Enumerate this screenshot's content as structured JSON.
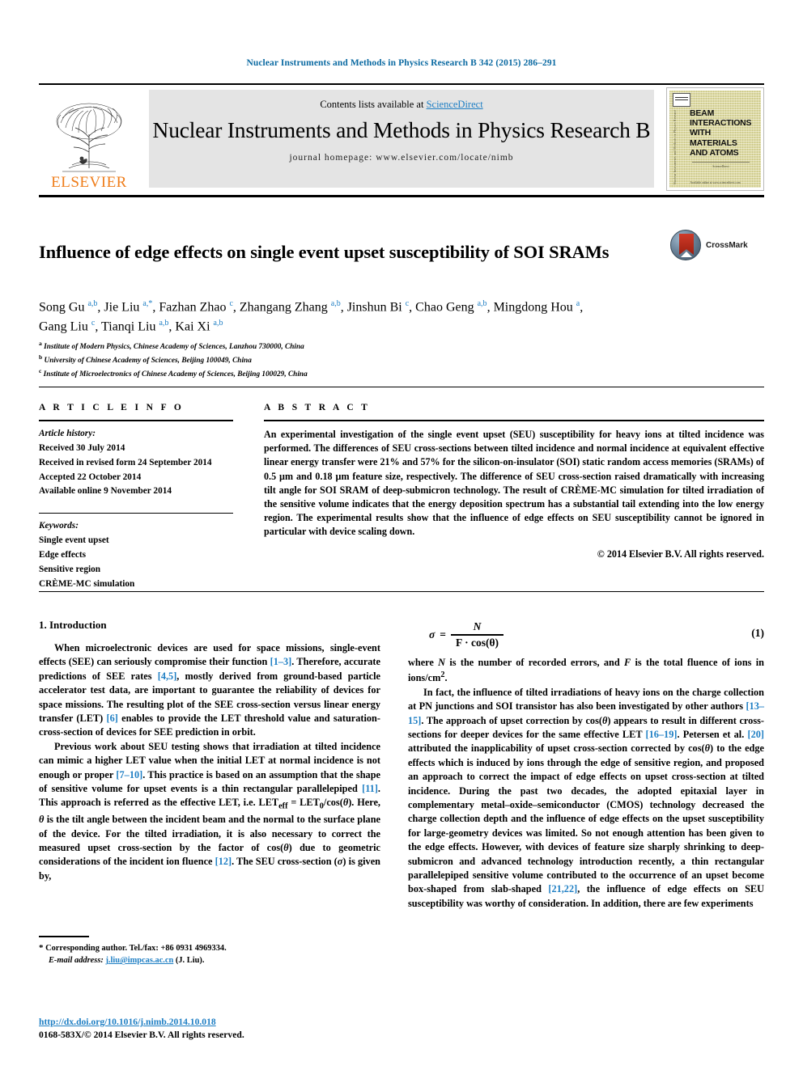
{
  "running_head": "Nuclear Instruments and Methods in Physics Research B 342 (2015) 286–291",
  "masthead": {
    "contents_prefix": "Contents lists available at ",
    "sciencedirect": "ScienceDirect",
    "journal_title": "Nuclear Instruments and Methods in Physics Research B",
    "homepage": "journal homepage: www.elsevier.com/locate/nimb",
    "publisher_wordmark": "ELSEVIER",
    "cover": {
      "title_lines": [
        "BEAM",
        "INTERACTIONS",
        "WITH",
        "MATERIALS",
        "AND ATOMS"
      ],
      "spine_text": "Nuclear Instruments and Methods in Physics Research B",
      "mid_text": "ScienceDirect",
      "foot_text": "Available online at www.sciencedirect.com"
    }
  },
  "article": {
    "title": "Influence of edge effects on single event upset susceptibility of SOI SRAMs",
    "crossmark_label": "CrossMark",
    "authors_line1": "Song Gu a,b, Jie Liu a,*, Fazhan Zhao c, Zhangang Zhang a,b, Jinshun Bi c, Chao Geng a,b, Mingdong Hou a,",
    "authors_line2": "Gang Liu c, Tianqi Liu a,b, Kai Xi a,b",
    "authors": [
      {
        "name": "Song Gu",
        "sup": "a,b"
      },
      {
        "name": "Jie Liu",
        "sup": "a,*"
      },
      {
        "name": "Fazhan Zhao",
        "sup": "c"
      },
      {
        "name": "Zhangang Zhang",
        "sup": "a,b"
      },
      {
        "name": "Jinshun Bi",
        "sup": "c"
      },
      {
        "name": "Chao Geng",
        "sup": "a,b"
      },
      {
        "name": "Mingdong Hou",
        "sup": "a"
      },
      {
        "name": "Gang Liu",
        "sup": "c"
      },
      {
        "name": "Tianqi Liu",
        "sup": "a,b"
      },
      {
        "name": "Kai Xi",
        "sup": "a,b"
      }
    ],
    "affiliations": [
      {
        "mark": "a",
        "text": "Institute of Modern Physics, Chinese Academy of Sciences, Lanzhou 730000, China"
      },
      {
        "mark": "b",
        "text": "University of Chinese Academy of Sciences, Beijing 100049, China"
      },
      {
        "mark": "c",
        "text": "Institute of Microelectronics of Chinese Academy of Sciences, Beijing 100029, China"
      }
    ]
  },
  "article_info": {
    "heading": "A R T I C L E  I N F O",
    "history_label": "Article history:",
    "history": [
      "Received 30 July 2014",
      "Received in revised form 24 September 2014",
      "Accepted 22 October 2014",
      "Available online 9 November 2014"
    ],
    "keywords_label": "Keywords:",
    "keywords": [
      "Single event upset",
      "Edge effects",
      "Sensitive region",
      "CRÈME-MC simulation"
    ]
  },
  "abstract": {
    "heading": "A B S T R A C T",
    "text": "An experimental investigation of the single event upset (SEU) susceptibility for heavy ions at tilted incidence was performed. The differences of SEU cross-sections between tilted incidence and normal incidence at equivalent effective linear energy transfer were 21% and 57% for the silicon-on-insulator (SOI) static random access memories (SRAMs) of 0.5 µm and 0.18 µm feature size, respectively. The difference of SEU cross-section raised dramatically with increasing tilt angle for SOI SRAM of deep-submicron technology. The result of CRÈME-MC simulation for tilted irradiation of the sensitive volume indicates that the energy deposition spectrum has a substantial tail extending into the low energy region. The experimental results show that the influence of edge effects on SEU susceptibility cannot be ignored in particular with device scaling down.",
    "copyright": "© 2014 Elsevier B.V. All rights reserved."
  },
  "body": {
    "section_heading": "1. Introduction",
    "left_paragraphs": [
      "When microelectronic devices are used for space missions, single-event effects (SEE) can seriously compromise their function [1–3]. Therefore, accurate predictions of SEE rates [4,5], mostly derived from ground-based particle accelerator test data, are important to guarantee the reliability of devices for space missions. The resulting plot of the SEE cross-section versus linear energy transfer (LET) [6] enables to provide the LET threshold value and saturation-cross-section of devices for SEE prediction in orbit.",
      "Previous work about SEU testing shows that irradiation at tilted incidence can mimic a higher LET value when the initial LET at normal incidence is not enough or proper [7–10]. This practice is based on an assumption that the shape of sensitive volume for upset events is a thin rectangular parallelepiped [11]. This approach is referred as the effective LET, i.e. LETeff = LET0/cos(θ). Here, θ is the tilt angle between the incident beam and the normal to the surface plane of the device. For the tilted irradiation, it is also necessary to correct the measured upset cross-section by the factor of cos(θ) due to geometric considerations of the incident ion fluence [12]. The SEU cross-section (σ) is given by,"
    ],
    "equation": {
      "lhs": "σ",
      "equals": "=",
      "numerator": "N",
      "denominator": "F · cos(θ)",
      "number": "(1)"
    },
    "right_paragraphs": [
      "where N is the number of recorded errors, and F is the total fluence of ions in ions/cm2.",
      "In fact, the influence of tilted irradiations of heavy ions on the charge collection at PN junctions and SOI transistor has also been investigated by other authors [13–15]. The approach of upset correction by cos(θ) appears to result in different cross-sections for deeper devices for the same effective LET [16–19]. Petersen et al. [20] attributed the inapplicability of upset cross-section corrected by cos(θ) to the edge effects which is induced by ions through the edge of sensitive region, and proposed an approach to correct the impact of edge effects on upset cross-section at tilted incidence. During the past two decades, the adopted epitaxial layer in complementary metal–oxide–semiconductor (CMOS) technology decreased the charge collection depth and the influence of edge effects on the upset susceptibility for large-geometry devices was limited. So not enough attention has been given to the edge effects. However, with devices of feature size sharply shrinking to deep-submicron and advanced technology introduction recently, a thin rectangular parallelepiped sensitive volume contributed to the occurrence of an upset become box-shaped from slab-shaped [21,22], the influence of edge effects on SEU susceptibility was worthy of consideration. In addition, there are few experiments"
    ]
  },
  "footnote": {
    "star": "*",
    "corresponding": "Corresponding author. Tel./fax: +86 0931 4969334.",
    "email_label": "E-mail address:",
    "email": "j.liu@impcas.ac.cn",
    "email_suffix": "(J. Liu)."
  },
  "page_footer": {
    "doi": "http://dx.doi.org/10.1016/j.nimb.2014.10.018",
    "issn": "0168-583X/© 2014 Elsevier B.V. All rights reserved."
  },
  "colors": {
    "link": "#1f7fc4",
    "running_head": "#0b6aa2",
    "elsevier_orange": "#ef7d1a",
    "band_gray": "#e4e4e4"
  }
}
